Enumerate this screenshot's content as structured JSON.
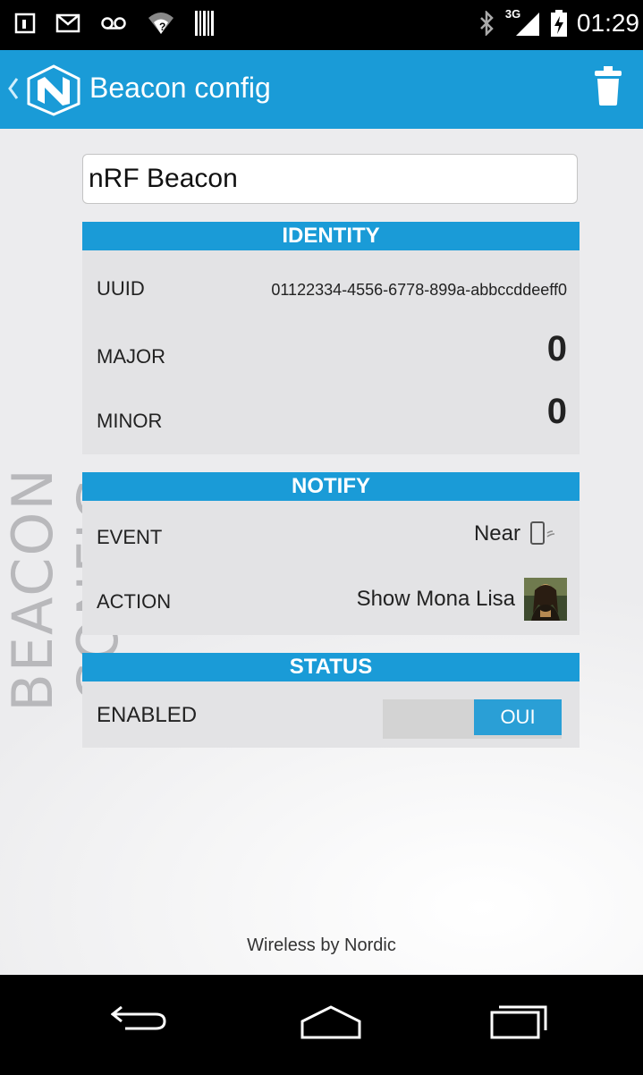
{
  "status_bar": {
    "time": "01:29",
    "network_label": "3G",
    "icons": [
      "sim-icon",
      "gmail-icon",
      "voicemail-icon",
      "wifi-alert-icon",
      "barcode-icon",
      "bluetooth-icon",
      "signal-icon",
      "battery-charging-icon"
    ]
  },
  "action_bar": {
    "title": "Beacon config",
    "icons": [
      "back-icon",
      "nordic-logo-icon",
      "trash-icon"
    ]
  },
  "vertical_title": "BEACON CONFIG",
  "beacon_name": "nRF Beacon",
  "identity": {
    "header": "IDENTITY",
    "uuid_label": "UUID",
    "uuid_value": "01122334-4556-6778-899a-abbccddeeff0",
    "major_label": "MAJOR",
    "major_value": "0",
    "minor_label": "MINOR",
    "minor_value": "0"
  },
  "notify": {
    "header": "NOTIFY",
    "event_label": "EVENT",
    "event_value": "Near",
    "action_label": "ACTION",
    "action_value": "Show Mona Lisa"
  },
  "status": {
    "header": "STATUS",
    "enabled_label": "ENABLED",
    "toggle_label": "OUI"
  },
  "footer": "Wireless by Nordic",
  "colors": {
    "accent": "#1a9bd7",
    "section_bg": "#e3e3e5"
  }
}
